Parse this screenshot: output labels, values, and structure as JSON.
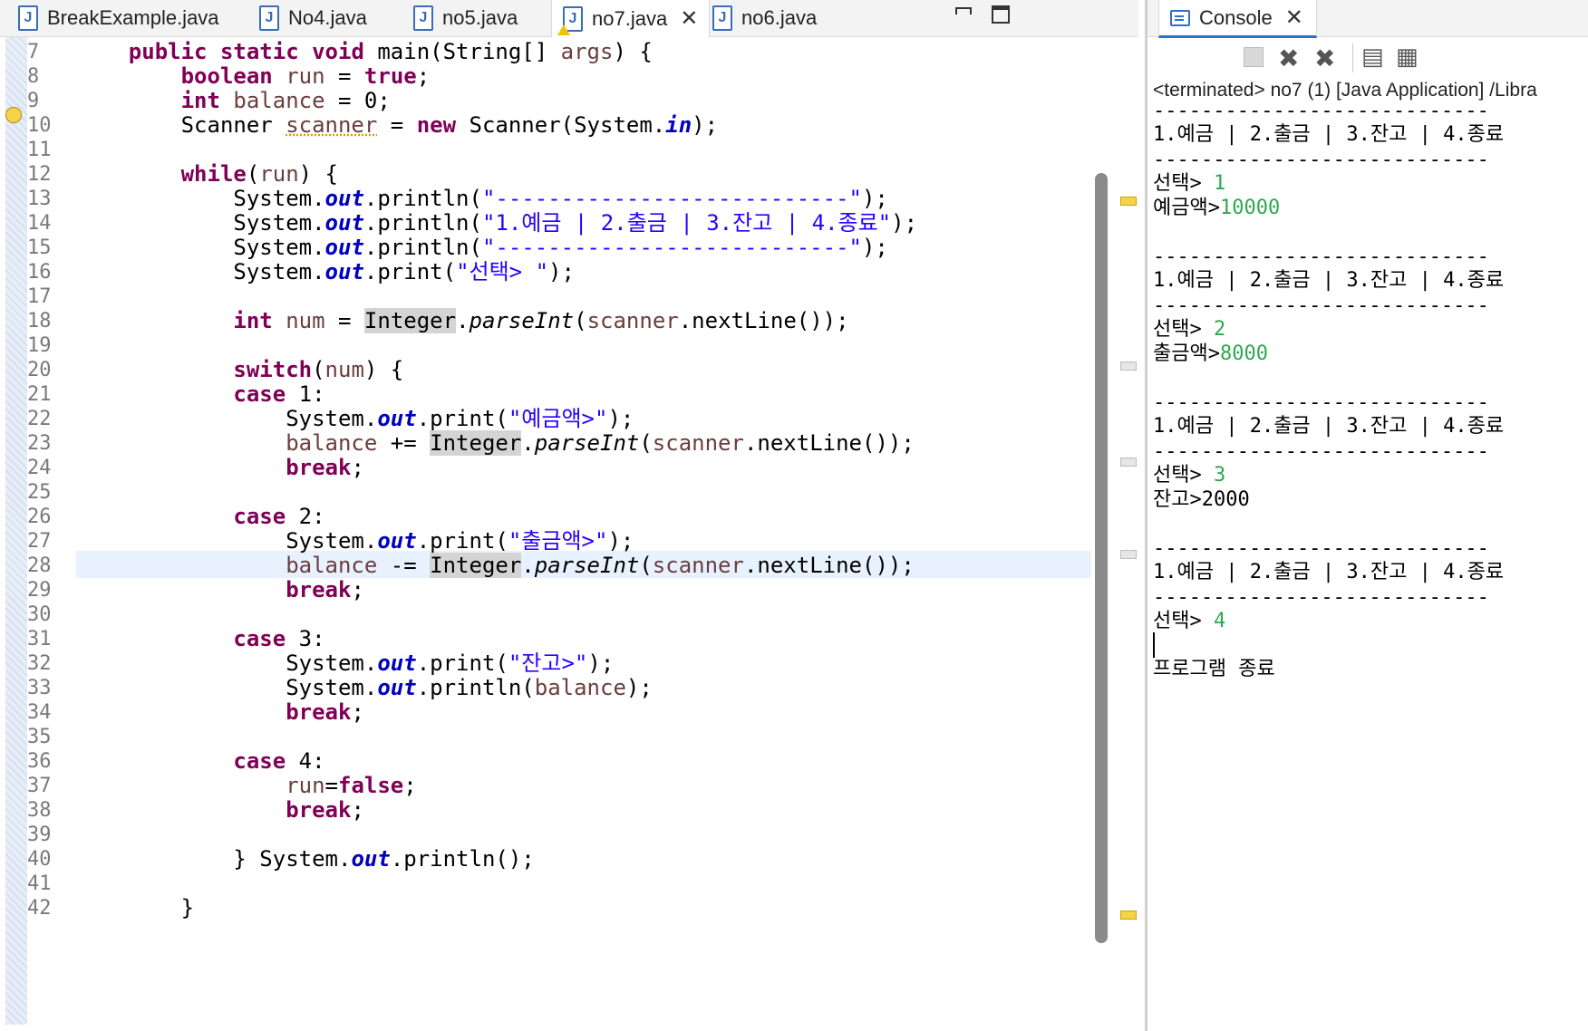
{
  "editor_tabs": [
    {
      "label": "BreakExample.java",
      "icon": "java-file-icon",
      "active": false,
      "warning": false
    },
    {
      "label": "No4.java",
      "icon": "java-file-icon",
      "active": false,
      "warning": false
    },
    {
      "label": "no5.java",
      "icon": "java-file-icon",
      "active": false,
      "warning": false
    },
    {
      "label": "no7.java",
      "icon": "java-file-warning-icon",
      "active": true,
      "warning": true
    },
    {
      "label": "no6.java",
      "icon": "java-file-icon",
      "active": false,
      "warning": false
    }
  ],
  "editor": {
    "line_numbers": [
      "7",
      "8",
      "9",
      "10",
      "11",
      "12",
      "13",
      "14",
      "15",
      "16",
      "17",
      "18",
      "19",
      "20",
      "21",
      "22",
      "23",
      "24",
      "25",
      "26",
      "27",
      "28",
      "29",
      "30",
      "31",
      "32",
      "33",
      "34",
      "35",
      "36",
      "37",
      "38",
      "39",
      "40",
      "41",
      "42"
    ],
    "current_line": "28",
    "tokens": {
      "l7": [
        "    ",
        "public",
        " ",
        "static",
        " ",
        "void",
        " main(String[] ",
        "args",
        ") {"
      ],
      "l8": [
        "        ",
        "boolean",
        " ",
        "run",
        " = ",
        "true",
        ";"
      ],
      "l9": [
        "        ",
        "int",
        " ",
        "balance",
        " = 0;"
      ],
      "l10": [
        "        Scanner ",
        "scanner",
        " = ",
        "new",
        " Scanner(System.",
        "in",
        ");"
      ],
      "l12": [
        "        ",
        "while",
        "(",
        "run",
        ") {"
      ],
      "l13": [
        "            System.",
        "out",
        ".println(",
        "\"---------------------------\"",
        ");"
      ],
      "l14": [
        "            System.",
        "out",
        ".println(",
        "\"1.예금 | 2.출금 | 3.잔고 | 4.종료\"",
        ");"
      ],
      "l15": [
        "            System.",
        "out",
        ".println(",
        "\"---------------------------\"",
        ");"
      ],
      "l16": [
        "            System.",
        "out",
        ".print(",
        "\"선택> \"",
        ");"
      ],
      "l18": [
        "            ",
        "int",
        " ",
        "num",
        " = ",
        "Integer",
        ".",
        "parseInt",
        "(",
        "scanner",
        ".nextLine());"
      ],
      "l20": [
        "            ",
        "switch",
        "(",
        "num",
        ") {"
      ],
      "l21": [
        "            ",
        "case",
        " 1:"
      ],
      "l22": [
        "                System.",
        "out",
        ".print(",
        "\"예금액>\"",
        ");"
      ],
      "l23": [
        "                ",
        "balance",
        " += ",
        "Integer",
        ".",
        "parseInt",
        "(",
        "scanner",
        ".nextLine());"
      ],
      "l24": [
        "                ",
        "break",
        ";"
      ],
      "l26": [
        "            ",
        "case",
        " 2:"
      ],
      "l27": [
        "                System.",
        "out",
        ".print(",
        "\"출금액>\"",
        ");"
      ],
      "l28": [
        "                ",
        "balance",
        " -= ",
        "Integer",
        ".",
        "parseInt",
        "(",
        "scanner",
        ".nextLine());"
      ],
      "l29": [
        "                ",
        "break",
        ";"
      ],
      "l31": [
        "            ",
        "case",
        " 3:"
      ],
      "l32": [
        "                System.",
        "out",
        ".print(",
        "\"잔고>\"",
        ");"
      ],
      "l33": [
        "                System.",
        "out",
        ".println(",
        "balance",
        ");"
      ],
      "l34": [
        "                ",
        "break",
        ";"
      ],
      "l36": [
        "            ",
        "case",
        " 4:"
      ],
      "l37": [
        "                ",
        "run",
        "=",
        "false",
        ";"
      ],
      "l38": [
        "                ",
        "break",
        ";"
      ],
      "l40": [
        "            } System.",
        "out",
        ".println();"
      ],
      "l42": [
        "        }"
      ]
    }
  },
  "console": {
    "tab_label": "Console",
    "status": "<terminated> no7 (1) [Java Application] /Libra",
    "menu_line": "1.예금 | 2.출금 | 3.잔고 | 4.종료",
    "dash_line": "----------------------------",
    "prompt": "선택> ",
    "inputs": [
      "1",
      "2",
      "3",
      "4"
    ],
    "deposit_prompt": "예금액>",
    "deposit_value": "10000",
    "withdraw_prompt": "출금액>",
    "withdraw_value": "8000",
    "balance_output": "잔고>2000",
    "end_message": "프로그램 종료"
  },
  "colors": {
    "keyword": "#7f0055",
    "string": "#2a00ff",
    "static_field": "#0000c0",
    "local_variable": "#6a3e3e",
    "console_input": "#2fa84f",
    "current_line": "#e8f2fe",
    "occurrence_highlight": "#d4d4d4"
  }
}
